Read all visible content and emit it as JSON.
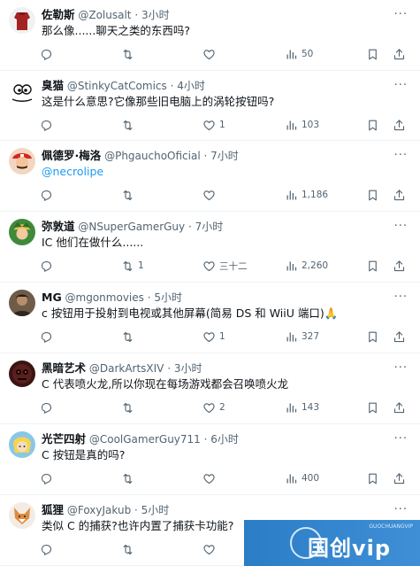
{
  "tweets": [
    {
      "name": "佐勒斯",
      "handle": "@Zolusalt",
      "time": "3小时",
      "text": "那么像......聊天之类的东西吗?",
      "mention": false,
      "reply_count": "",
      "retweet_count": "",
      "like_count": "",
      "view_count": "50",
      "avatar_icon": "red-shirt-avatar"
    },
    {
      "name": "臭猫",
      "handle": "@StinkyCatComics",
      "time": "4小时",
      "text": "这是什么意思?它像那些旧电脑上的涡轮按钮吗?",
      "mention": false,
      "reply_count": "",
      "retweet_count": "",
      "like_count": "1",
      "view_count": "103",
      "avatar_icon": "cartoon-cat-avatar"
    },
    {
      "name": "佩德罗·梅洛",
      "handle": "@PhgauchoOficial",
      "time": "7小时",
      "text": "@necrolipe",
      "mention": true,
      "reply_count": "",
      "retweet_count": "",
      "like_count": "",
      "view_count": "1,186",
      "avatar_icon": "mario-avatar"
    },
    {
      "name": "弥敦道",
      "handle": "@NSuperGamerGuy",
      "time": "7小时",
      "text": "IC 他们在做什么......",
      "mention": false,
      "reply_count": "",
      "retweet_count": "1",
      "like_count": "三十二",
      "view_count": "2,260",
      "avatar_icon": "link-avatar"
    },
    {
      "name": "MG",
      "handle": "@mgonmovies",
      "time": "5小时",
      "text": "c 按钮用于投射到电视或其他屏幕(简易 DS 和 WiiU 端口)🙏",
      "mention": false,
      "reply_count": "",
      "retweet_count": "",
      "like_count": "1",
      "view_count": "327",
      "avatar_icon": "person-avatar"
    },
    {
      "name": "黑暗艺术",
      "handle": "@DarkArtsXIV",
      "time": "3小时",
      "text": "C 代表喷火龙,所以你现在每场游戏都会召唤喷火龙",
      "mention": false,
      "reply_count": "",
      "retweet_count": "",
      "like_count": "2",
      "view_count": "143",
      "avatar_icon": "dark-mask-avatar"
    },
    {
      "name": "光芒四射",
      "handle": "@CoolGamerGuy711",
      "time": "6小时",
      "text": "C 按钮是真的吗?",
      "mention": false,
      "reply_count": "",
      "retweet_count": "",
      "like_count": "",
      "view_count": "400",
      "avatar_icon": "anime-avatar"
    },
    {
      "name": "狐狸",
      "handle": "@FoxyJakub",
      "time": "5小时",
      "text": "类似 C 的捕获?也许内置了捕获卡功能?",
      "mention": false,
      "reply_count": "",
      "retweet_count": "",
      "like_count": "",
      "view_count": "",
      "avatar_icon": "fox-avatar"
    }
  ],
  "watermark": {
    "text": "国创vip",
    "small": "GUOCHUANGVIP"
  },
  "icons": {
    "reply": "reply-icon",
    "retweet": "retweet-icon",
    "like": "heart-icon",
    "views": "views-icon",
    "bookmark": "bookmark-icon",
    "share": "share-icon",
    "more": "more-icon"
  },
  "colors": {
    "link": "#1d9bf0",
    "muted": "#536471",
    "text": "#0f1419"
  }
}
